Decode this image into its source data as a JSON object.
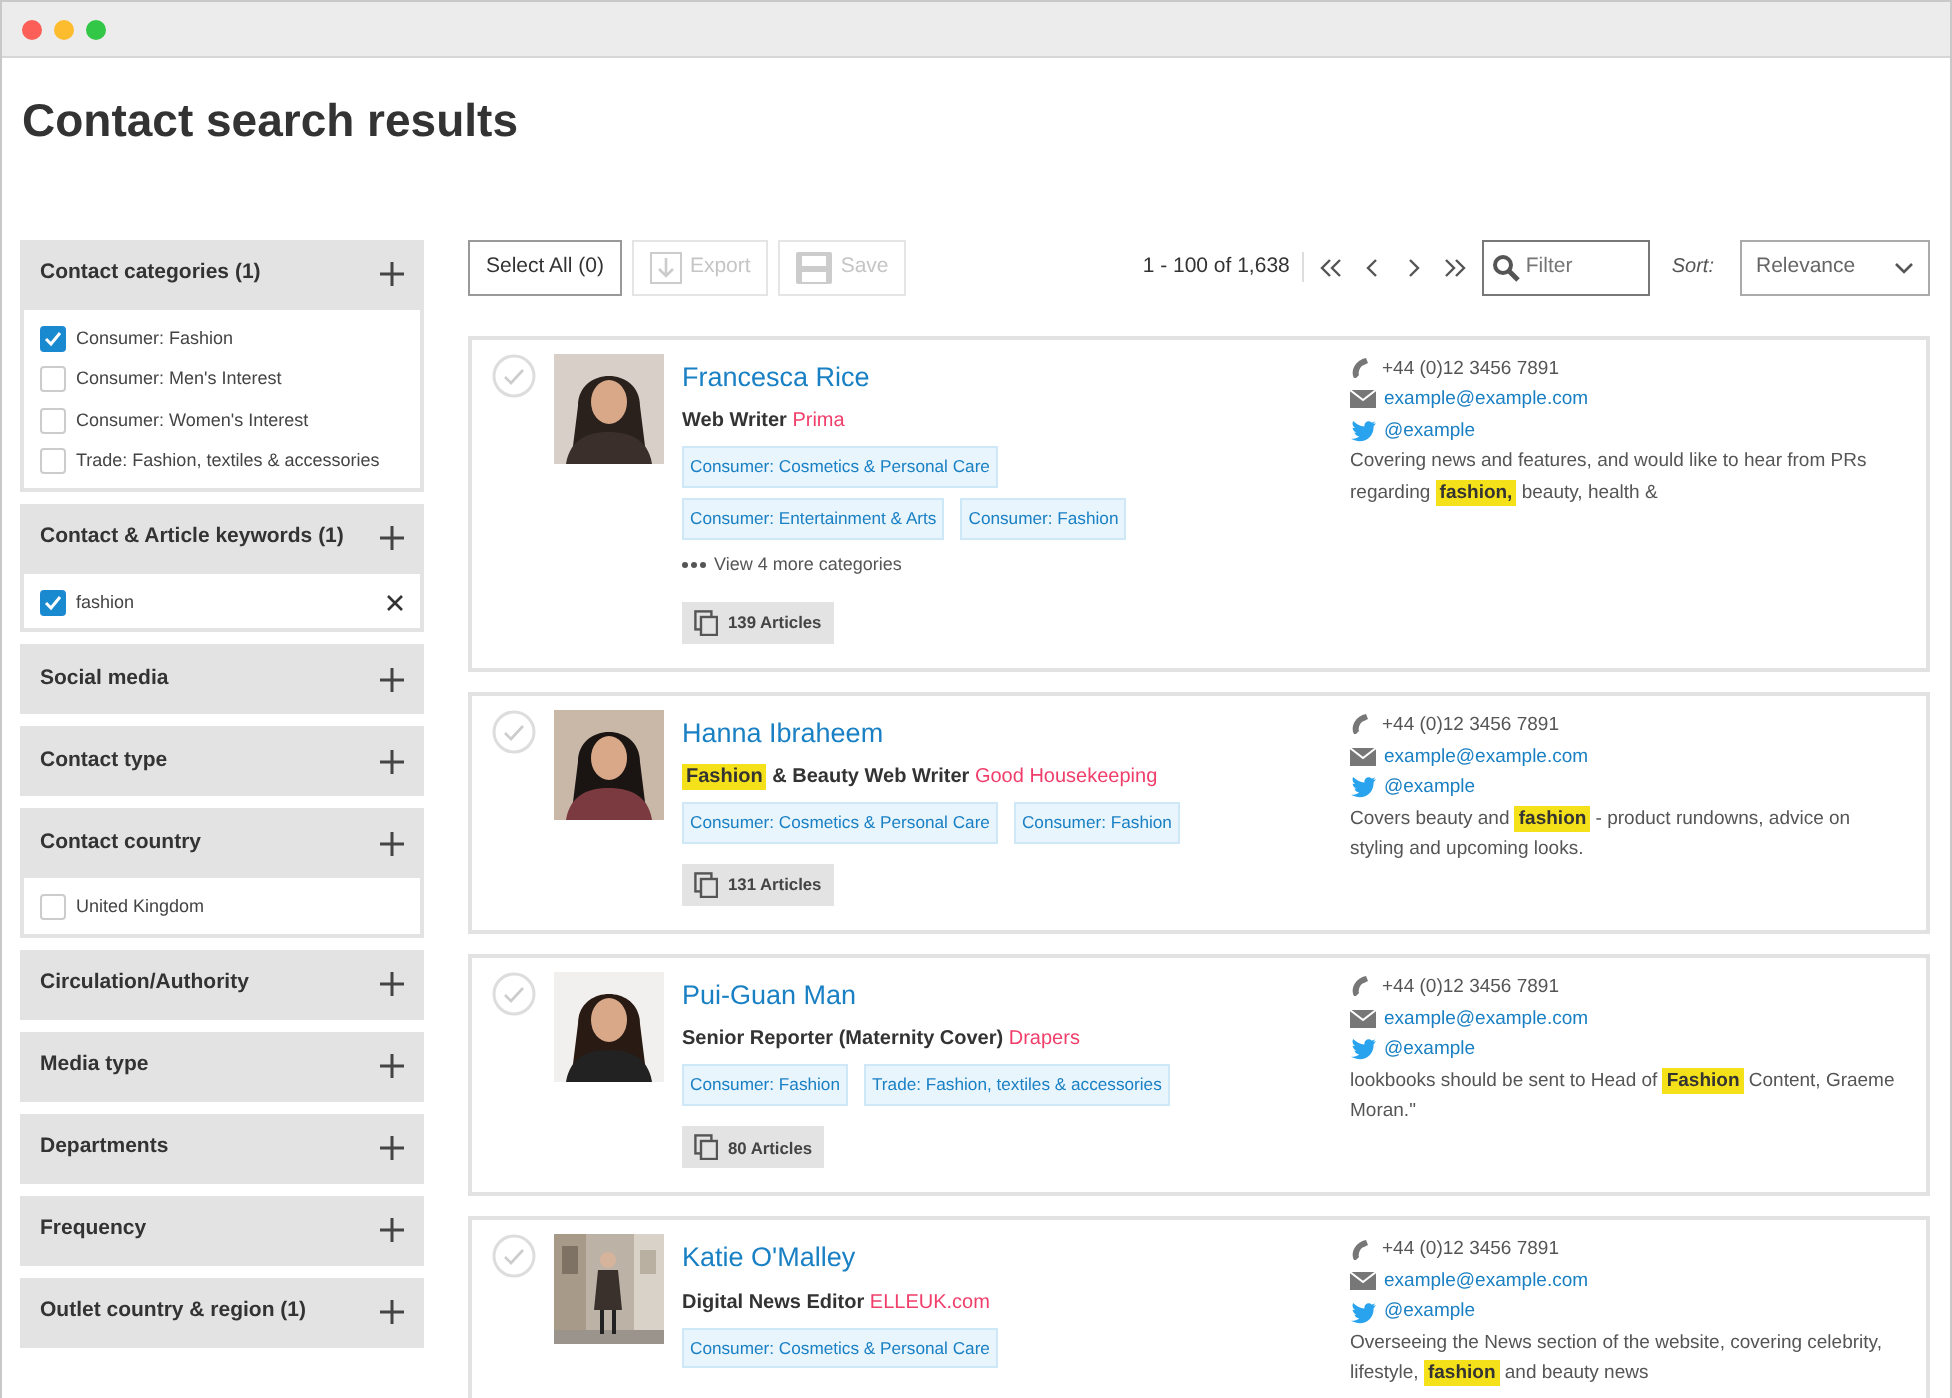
{
  "page": {
    "title": "Contact search results"
  },
  "filters": [
    {
      "title": "Contact categories (1)",
      "options": [
        {
          "label": "Consumer: Fashion",
          "checked": true,
          "removable": false
        },
        {
          "label": "Consumer: Men's Interest",
          "checked": false,
          "removable": false
        },
        {
          "label": "Consumer: Women's Interest",
          "checked": false,
          "removable": false
        },
        {
          "label": "Trade: Fashion, textiles & accessories",
          "checked": false,
          "removable": false
        }
      ]
    },
    {
      "title": "Contact & Article keywords (1)",
      "options": [
        {
          "label": "fashion",
          "checked": true,
          "removable": true
        }
      ]
    },
    {
      "title": "Social media"
    },
    {
      "title": "Contact type"
    },
    {
      "title": "Contact country",
      "options": [
        {
          "label": "United Kingdom",
          "checked": false,
          "removable": false
        }
      ]
    },
    {
      "title": "Circulation/Authority"
    },
    {
      "title": "Media type"
    },
    {
      "title": "Departments"
    },
    {
      "title": "Frequency"
    },
    {
      "title": "Outlet country & region (1)"
    }
  ],
  "toolbar": {
    "buttons": [
      {
        "label": "Select All (0)",
        "kind": "plain",
        "disabled": false
      },
      {
        "label": "Export",
        "kind": "export",
        "disabled": true
      },
      {
        "label": "Save",
        "kind": "save",
        "disabled": true
      }
    ],
    "range": "1 - 100 of 1,638",
    "filter": {
      "placeholder": "Filter"
    },
    "sort_label": "Sort:",
    "sort_value": "Relevance"
  },
  "contacts": [
    {
      "name": "Francesca Rice",
      "role": "Web Writer",
      "outlet": "Prima",
      "tags": [
        "Consumer: Cosmetics & Personal Care",
        "Consumer: Entertainment & Arts",
        "Consumer: Fashion"
      ],
      "more": "View 4 more categories",
      "articles": "139 Articles",
      "phone": "+44 (0)12 3456 7891",
      "email": "example@example.com",
      "twitter": "@example",
      "description": "Covering news and features, and would like to hear from PRs regarding **fashion,** beauty, health &",
      "selected": false
    },
    {
      "name": "Hanna Ibraheem",
      "role": "**Fashion** & Beauty Web Writer",
      "outlet": "Good Housekeeping",
      "tags": [
        "Consumer: Cosmetics & Personal Care",
        "Consumer: Fashion"
      ],
      "articles": "131 Articles",
      "phone": "+44 (0)12 3456 7891",
      "email": "example@example.com",
      "twitter": "@example",
      "description": "Covers beauty and **fashion** - product rundowns, advice on styling and upcoming looks.",
      "selected": false
    },
    {
      "name": "Pui-Guan Man",
      "role": "Senior Reporter (Maternity Cover)",
      "outlet": "Drapers",
      "tags": [
        "Consumer: Fashion",
        "Trade: Fashion, textiles & accessories"
      ],
      "articles": "80 Articles",
      "phone": "+44 (0)12 3456 7891",
      "email": "example@example.com",
      "twitter": "@example",
      "description": "lookbooks should be sent to Head of **Fashion** Content, Graeme Moran.\"",
      "selected": false
    },
    {
      "name": "Katie O'Malley",
      "role": "Digital News Editor",
      "outlet": "ELLEUK.com",
      "tags": [
        "Consumer: Cosmetics & Personal Care"
      ],
      "phone": "+44 (0)12 3456 7891",
      "email": "example@example.com",
      "twitter": "@example",
      "description": "Overseeing the News section of the website, covering celebrity, lifestyle, **fashion** and beauty news",
      "selected": false
    }
  ]
}
